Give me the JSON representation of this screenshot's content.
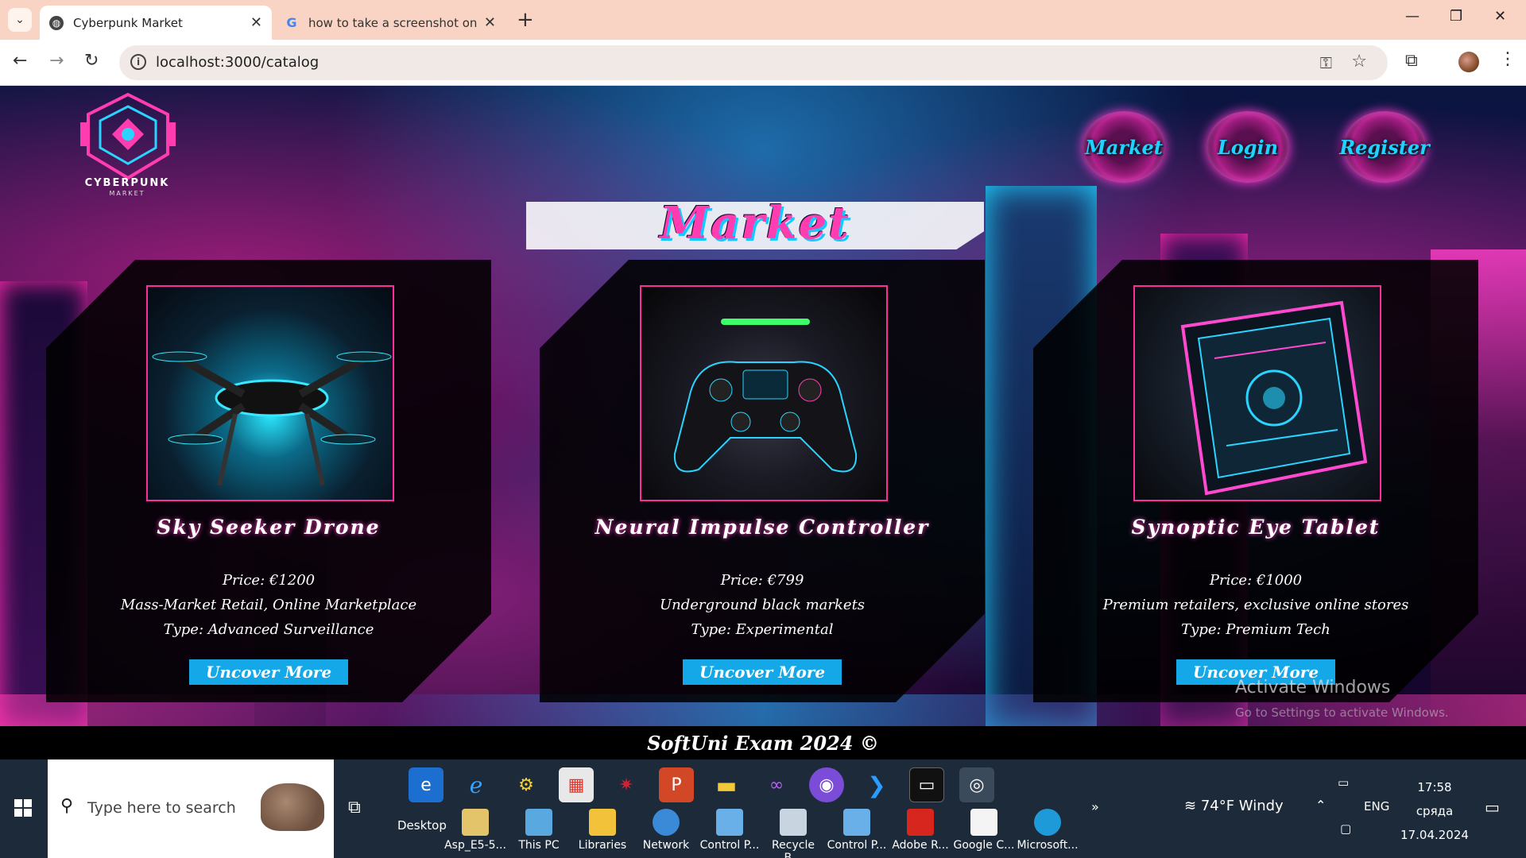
{
  "browser": {
    "tabs": [
      {
        "title": "Cyberpunk Market",
        "active": true
      },
      {
        "title": "how to take a screenshot on pc",
        "active": false
      }
    ],
    "url": "localhost:3000/catalog"
  },
  "site": {
    "logo_text": "CYBERPUNK",
    "logo_sub": "MARKET",
    "nav": [
      "Market",
      "Login",
      "Register"
    ],
    "page_title": "Market",
    "products": [
      {
        "name": "Sky Seeker Drone",
        "price": "Price: €1200",
        "where": "Mass-Market Retail, Online Marketplace",
        "type": "Type: Advanced Surveillance",
        "button": "Uncover More"
      },
      {
        "name": "Neural Impulse Controller",
        "price": "Price: €799",
        "where": "Underground black markets",
        "type": "Type: Experimental",
        "button": "Uncover More"
      },
      {
        "name": "Synoptic Eye Tablet",
        "price": "Price: €1000",
        "where": "Premium retailers, exclusive online stores",
        "type": "Type: Premium Tech",
        "button": "Uncover More"
      }
    ],
    "footer": "SoftUni Exam 2024 ©",
    "watermark": {
      "title": "Activate Windows",
      "subtitle": "Go to Settings to activate Windows."
    }
  },
  "taskbar": {
    "search_placeholder": "Type here to search",
    "desktop_label": "Desktop",
    "desktop_items": [
      "Asp_E5-5...",
      "This PC",
      "Libraries",
      "Network",
      "Control P...",
      "Recycle B...",
      "Control P...",
      "Adobe R...",
      "Google C...",
      "Microsoft..."
    ],
    "more": "»",
    "weather": "74°F  Windy",
    "language": "ENG",
    "time": "17:58",
    "day": "сряда",
    "date": "17.04.2024"
  },
  "colors": {
    "accent_pink": "#ff2d9c",
    "accent_cyan": "#14a8e8",
    "tabbar": "#f9d3c3"
  }
}
